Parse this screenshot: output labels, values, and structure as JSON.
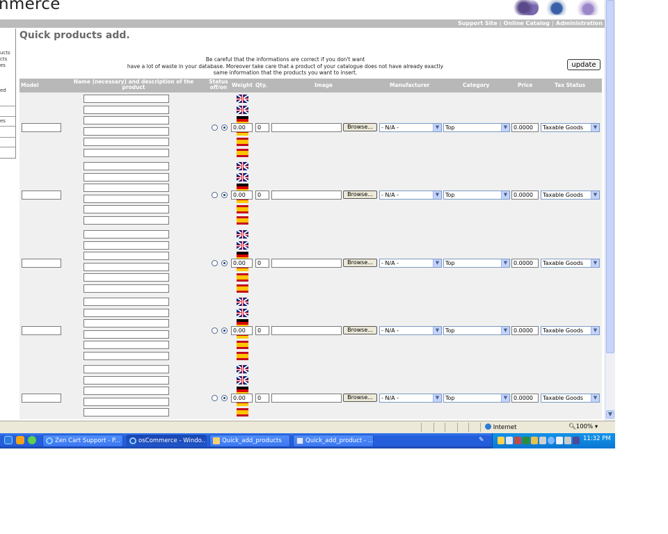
{
  "app": {
    "brand_partial": "nmerce"
  },
  "topnav": {
    "items": [
      "Support Site",
      "Online Catalog",
      "Administration"
    ],
    "separator": "|"
  },
  "sidebar": {
    "fragments": [
      "ucts",
      "cts",
      "es",
      "ed",
      "es"
    ]
  },
  "page": {
    "title": "Quick products add.",
    "warning_lines": [
      "Be careful that the informations are correct if you don't want",
      "have a lot of waste in your database. Moreover take care that a product of your catalogue does not have already exactly",
      "same information that the products you want to insert."
    ],
    "update_label": "update"
  },
  "table": {
    "headers": {
      "model": "Model",
      "name": "Name (necessary) and description of the product",
      "status": "Status off/on",
      "weight": "Weight",
      "qty": "Qty.",
      "image": "Image",
      "manufacturer": "Manufacturer",
      "category": "Category",
      "price": "Price",
      "tax": "Tax Status"
    },
    "row_defaults": {
      "weight": "0.00",
      "qty": "0",
      "browse_label": "Browse...",
      "manufacturer": "- N/A -",
      "category": "Top",
      "price": "0.0000",
      "tax": "Taxable Goods"
    },
    "name_flags": [
      "uk",
      "uk",
      "de",
      "de",
      "es",
      "es"
    ],
    "row_count": 5
  },
  "statusbar": {
    "zone": "Internet",
    "zoom": "100%"
  },
  "taskbar": {
    "buttons": [
      "Zen Cart Support - P...",
      "osCommerce - Windo...",
      "Quick_add_products",
      "Quick_add_product - ..."
    ],
    "clock": "11:32 PM"
  }
}
